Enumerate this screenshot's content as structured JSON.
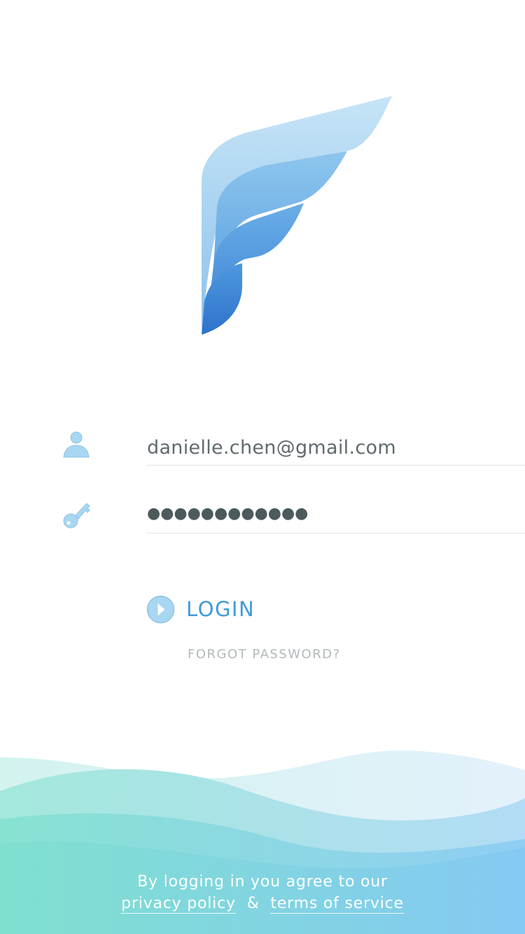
{
  "login_form": {
    "email": {
      "icon": "user-icon",
      "value": "danielle.chen@gmail.com"
    },
    "password": {
      "icon": "key-icon",
      "masked_value": "●●●●●●●●●●●●"
    },
    "login_button": {
      "icon": "play-circle-icon",
      "label": "LOGIN"
    },
    "forgot_password_label": "FORGOT PASSWORD?"
  },
  "footer": {
    "line1": "By logging in you agree to our",
    "privacy_policy_label": "privacy policy",
    "separator": "&",
    "terms_label": "terms of service"
  },
  "colors": {
    "accent": "#3f9ad8",
    "icon_blue": "#a9d6f1",
    "text": "#5f6b6e",
    "muted": "#b3b9bb"
  }
}
